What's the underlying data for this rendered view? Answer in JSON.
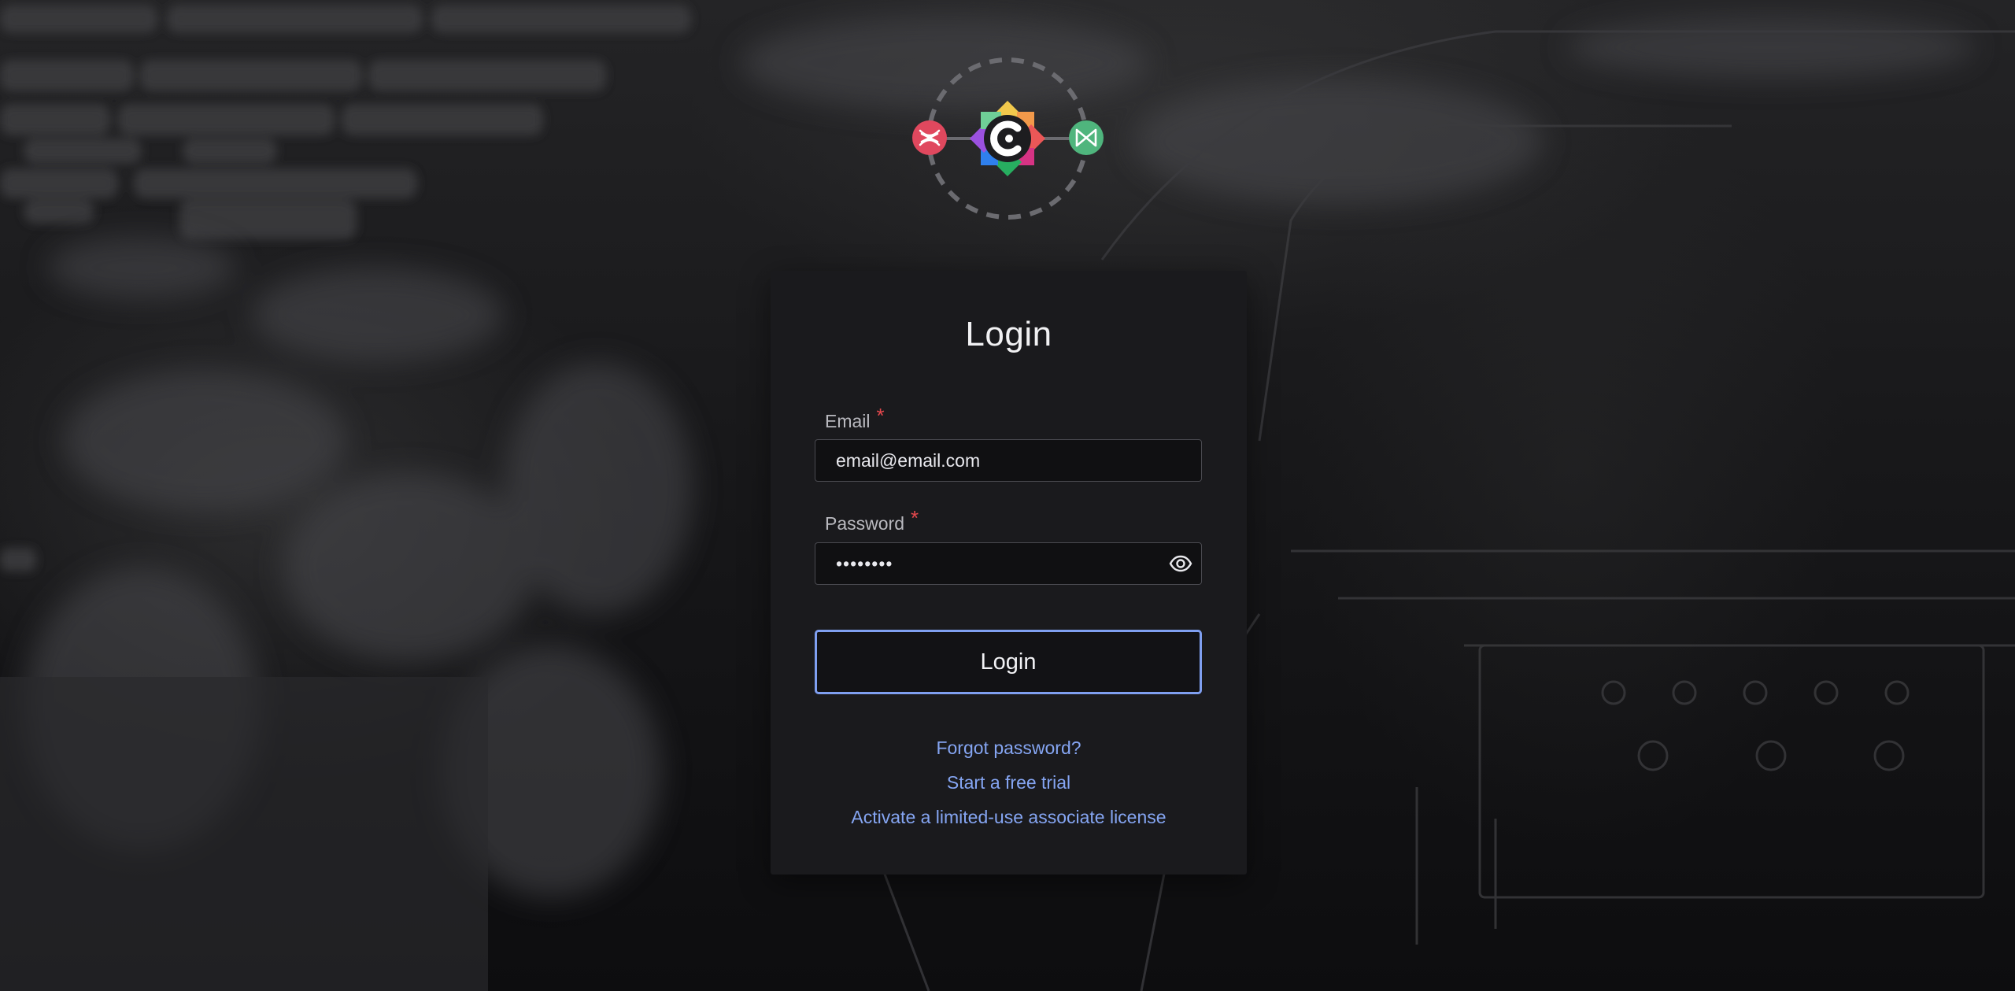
{
  "login": {
    "title": "Login",
    "email": {
      "label": "Email",
      "required_mark": "*",
      "value": "email@email.com"
    },
    "password": {
      "label": "Password",
      "required_mark": "*",
      "value": "password"
    },
    "submit_label": "Login",
    "links": {
      "forgot_password": "Forgot password?",
      "free_trial": "Start a free trial",
      "associate_license": "Activate a limited-use associate license"
    }
  },
  "icons": {
    "left_badge": "red-crossed-lines-icon",
    "center": "rainbow-c-logo-icon",
    "right_badge": "green-bowtie-icon",
    "password_toggle": "eye-icon"
  },
  "colors": {
    "accent": "#7f9ff0",
    "link": "#85a5f2",
    "required": "#e5484d",
    "card": "#1a1a1d",
    "left_badge": "#e0485e",
    "right_badge": "#4fb57d"
  }
}
